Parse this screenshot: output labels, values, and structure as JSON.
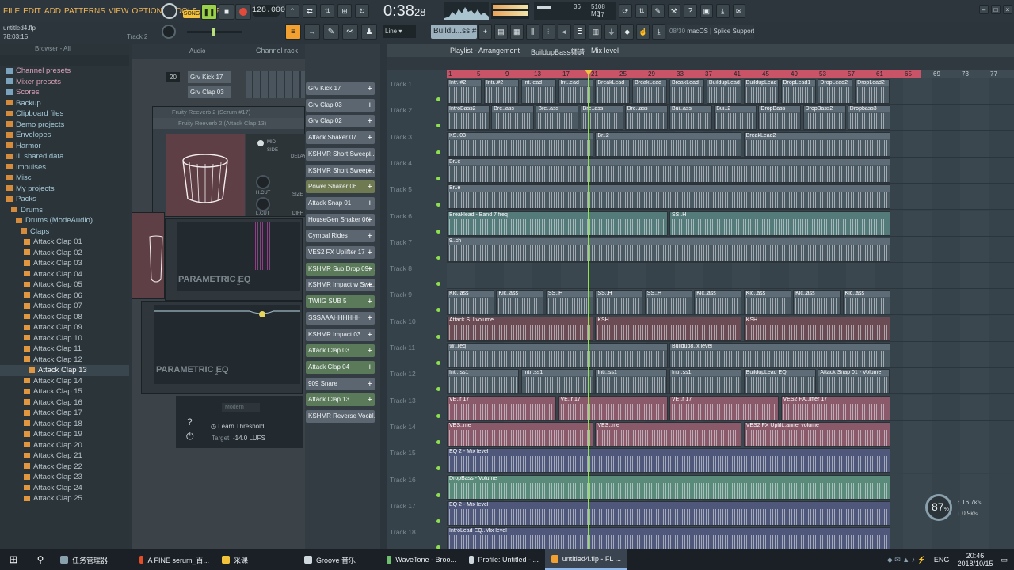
{
  "menu": [
    "FILE",
    "EDIT",
    "ADD",
    "PATTERNS",
    "VIEW",
    "OPTIONS",
    "TOOLS",
    "HELP"
  ],
  "transport": {
    "mode": "SONG",
    "tempo": "128.000",
    "time": "0:38",
    "time_sub": "28",
    "cpu_top": "36",
    "mem": "5108 MB",
    "voices": "17"
  },
  "project": {
    "file": "untitled4.flp",
    "time": "78:03:15",
    "track": "Track 2"
  },
  "pattern": {
    "name": "Buildu...ss #2",
    "snap": "Line"
  },
  "info": {
    "hint_count": "08/30",
    "hint_text": "macOS | Splice Support"
  },
  "browser": {
    "title": "Browser - All",
    "items": [
      {
        "label": "Channel presets",
        "type": "plug"
      },
      {
        "label": "Mixer presets",
        "type": "plug"
      },
      {
        "label": "Scores",
        "type": "plug"
      },
      {
        "label": "Backup",
        "type": "folder"
      },
      {
        "label": "Clipboard files",
        "type": "folder"
      },
      {
        "label": "Demo projects",
        "type": "folder"
      },
      {
        "label": "Envelopes",
        "type": "folder"
      },
      {
        "label": "Harmor",
        "type": "folder"
      },
      {
        "label": "IL shared data",
        "type": "folder"
      },
      {
        "label": "Impulses",
        "type": "folder"
      },
      {
        "label": "Misc",
        "type": "folder"
      },
      {
        "label": "My projects",
        "type": "folder"
      },
      {
        "label": "Packs",
        "type": "folder"
      },
      {
        "label": "Drums",
        "type": "folder"
      },
      {
        "label": "Drums (ModeAudio)",
        "type": "folder"
      },
      {
        "label": "Claps",
        "type": "folder"
      },
      {
        "label": "Attack Clap 01",
        "type": "file"
      },
      {
        "label": "Attack Clap 02",
        "type": "file"
      },
      {
        "label": "Attack Clap 03",
        "type": "file"
      },
      {
        "label": "Attack Clap 04",
        "type": "file"
      },
      {
        "label": "Attack Clap 05",
        "type": "file"
      },
      {
        "label": "Attack Clap 06",
        "type": "file"
      },
      {
        "label": "Attack Clap 07",
        "type": "file"
      },
      {
        "label": "Attack Clap 08",
        "type": "file"
      },
      {
        "label": "Attack Clap 09",
        "type": "file"
      },
      {
        "label": "Attack Clap 10",
        "type": "file"
      },
      {
        "label": "Attack Clap 11",
        "type": "file"
      },
      {
        "label": "Attack Clap 12",
        "type": "file"
      },
      {
        "label": "Attack Clap 13",
        "type": "file",
        "selected": true
      },
      {
        "label": "Attack Clap 14",
        "type": "file"
      },
      {
        "label": "Attack Clap 15",
        "type": "file"
      },
      {
        "label": "Attack Clap 16",
        "type": "file"
      },
      {
        "label": "Attack Clap 17",
        "type": "file"
      },
      {
        "label": "Attack Clap 18",
        "type": "file"
      },
      {
        "label": "Attack Clap 19",
        "type": "file"
      },
      {
        "label": "Attack Clap 20",
        "type": "file"
      },
      {
        "label": "Attack Clap 21",
        "type": "file"
      },
      {
        "label": "Attack Clap 22",
        "type": "file"
      },
      {
        "label": "Attack Clap 23",
        "type": "file"
      },
      {
        "label": "Attack Clap 24",
        "type": "file"
      },
      {
        "label": "Attack Clap 25",
        "type": "file"
      }
    ]
  },
  "channel_rack": {
    "title": "Channel rack",
    "filter": "Audio",
    "swing": "20",
    "rows": [
      "Grv Kick 17",
      "Grv Clap 03"
    ]
  },
  "plugins": {
    "reverb_title": "Fruity Reeverb 2 (Serum #17)",
    "reverb_sub": "Fruity Reeverb 2 (Attack Clap 13)",
    "eq_title": "PARAMETRIC EQ",
    "eq_title2": "PARAMETRIC EQ",
    "eq_sub": "2",
    "learn": "Learn Threshold",
    "target_label": "Target",
    "target_value": "-14.0 LUFS",
    "modern": "Modern",
    "knobs": [
      "MID",
      "SIDE",
      "DELAY",
      "H.CUT",
      "L.CUT",
      "SIZE",
      "DIFF"
    ]
  },
  "playlist": {
    "title": "Playlist - Arrangement",
    "breadcrumb": "BuildupBass频谱",
    "breadcrumb2": "Mix level",
    "ruler": [
      "1",
      "5",
      "9",
      "13",
      "17",
      "21",
      "25",
      "29",
      "33",
      "37",
      "41",
      "45",
      "49",
      "53",
      "57",
      "61",
      "65",
      "69",
      "73",
      "77"
    ],
    "channel_buttons": [
      {
        "label": "Grv Kick 17",
        "c": "n"
      },
      {
        "label": "Grv Clap 03",
        "c": "n"
      },
      {
        "label": "Grv Clap 02",
        "c": "n"
      },
      {
        "label": "Attack Shaker 07",
        "c": "n"
      },
      {
        "label": "KSHMR Short Sweep...",
        "c": "n"
      },
      {
        "label": "KSHMR Short Sweep...",
        "c": "n"
      },
      {
        "label": "Power Shaker 06",
        "c": "o"
      },
      {
        "label": "Attack Snap 01",
        "c": "n"
      },
      {
        "label": "HouseGen Shaker 06",
        "c": "n"
      },
      {
        "label": "Cymbal Rides",
        "c": "n"
      },
      {
        "label": "VES2 FX Uplifter 17",
        "c": "n"
      },
      {
        "label": "KSHMR Sub Drop 09 - ...",
        "c": "g"
      },
      {
        "label": "KSHMR Impact w Swe...",
        "c": "n"
      },
      {
        "label": "TWIIG SUB 5",
        "c": "g"
      },
      {
        "label": "SSSAAAHHHHHH",
        "c": "n"
      },
      {
        "label": "KSHMR Impact 03",
        "c": "n"
      },
      {
        "label": "Attack Clap 03",
        "c": "g"
      },
      {
        "label": "Attack Clap 04",
        "c": "g"
      },
      {
        "label": "909 Snare",
        "c": "n"
      },
      {
        "label": "Attack Clap 13",
        "c": "g"
      },
      {
        "label": "KSHMR Reverse Vocal...",
        "c": "n"
      }
    ],
    "tracks": [
      "Track 1",
      "Track 2",
      "Track 3",
      "Track 4",
      "Track 5",
      "Track 6",
      "Track 7",
      "Track 8",
      "Track 9",
      "Track 10",
      "Track 11",
      "Track 12",
      "Track 13",
      "Track 14",
      "Track 15",
      "Track 16",
      "Track 17",
      "Track 18"
    ],
    "clips": [
      {
        "t": 0,
        "labels": [
          "Intr..#2",
          "Intr..#2",
          "Int..ead",
          "Int..ead",
          "BreakLead",
          "BreakLead",
          "BreakLead",
          "BuildupLead",
          "BuildupLead",
          "DropLead1",
          "DropLead2",
          "DropLead2"
        ]
      },
      {
        "t": 1,
        "labels": [
          "IntroBass2",
          "Bre..ass",
          "Bre..ass",
          "Bre..ass",
          "Bre..ass",
          "Bui..ass",
          "Bui..2",
          "DropBass",
          "DropBass2",
          "Dropbass3"
        ]
      },
      {
        "t": 2,
        "labels": [
          "KS..03",
          "Br..2",
          "BreakLead2"
        ]
      },
      {
        "t": 3,
        "labels": [
          "Br..e"
        ]
      },
      {
        "t": 4,
        "labels": [
          "Br..e"
        ]
      },
      {
        "t": 5,
        "labels": [
          "Breaklead - Band 7 freq",
          "SS..H"
        ]
      },
      {
        "t": 6,
        "labels": [
          "9..ch"
        ]
      },
      {
        "t": 8,
        "labels": [
          "Kic..ass",
          "Kic..ass",
          "SS..H",
          "SS..H",
          "SS..H",
          "Kic..ass",
          "Kic..ass",
          "Kic..ass",
          "Kic..ass"
        ]
      },
      {
        "t": 9,
        "labels": [
          "Attack S..l volume",
          "KSH..",
          "KSH.."
        ]
      },
      {
        "t": 10,
        "labels": [
          "效..req",
          "Buildup8..x level"
        ]
      },
      {
        "t": 11,
        "labels": [
          "Intr..ss1",
          "Intr..ss1",
          "Intr..ss1",
          "Intr..ss1",
          "BuildupLead EQ",
          "Attack Snap 01 - Volume"
        ]
      },
      {
        "t": 12,
        "labels": [
          "VE..r 17",
          "VE..r 17",
          "VE..r 17",
          "VES2 FX..lifter 17"
        ]
      },
      {
        "t": 13,
        "labels": [
          "VES..me",
          "VES..me",
          "VES2 FX Uplift..annel volume"
        ]
      },
      {
        "t": 14,
        "labels": [
          "EQ 2 - Mix level"
        ]
      },
      {
        "t": 15,
        "labels": [
          "DropBass - Volume"
        ]
      },
      {
        "t": 16,
        "labels": [
          "EQ 2 - Mix level"
        ]
      },
      {
        "t": 17,
        "labels": [
          "IntroLead EQ..Mix level"
        ]
      }
    ]
  },
  "meter": {
    "cpu": "87",
    "unit": "%",
    "up": "16.7",
    "down": "0.9",
    "rate": "K/s"
  },
  "taskbar": {
    "items": [
      "任务管理器",
      "A FINE serum_百...",
      "采课",
      "Groove 音乐",
      "WaveTone - Broo...",
      "Profile: Untitled - ...",
      "untitled4.flp - FL ..."
    ],
    "lang": "ENG",
    "time": "20:46",
    "date": "2018/10/15"
  }
}
